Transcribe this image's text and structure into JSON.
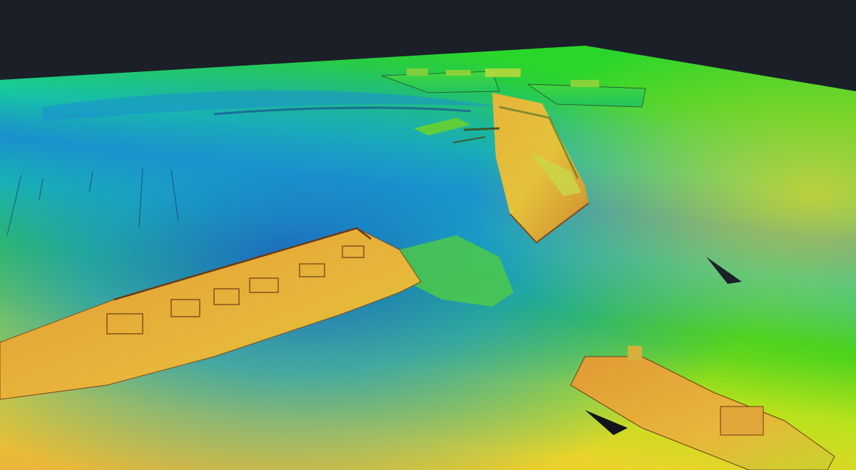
{
  "scene": {
    "kind": "multibeam-sonar-bathymetry",
    "background_color": "#1b1f28",
    "depth_palette": [
      "#e8a33a",
      "#f2d21c",
      "#b9e51a",
      "#3fd61a",
      "#14c79a",
      "#1592c9",
      "#1f63c4"
    ],
    "features": [
      "shipwreck-large-hull",
      "shipwreck-bow-upright",
      "shipwreck-distant-pair",
      "shipwreck-foreground-right",
      "debris-field",
      "seabed-channel"
    ]
  }
}
